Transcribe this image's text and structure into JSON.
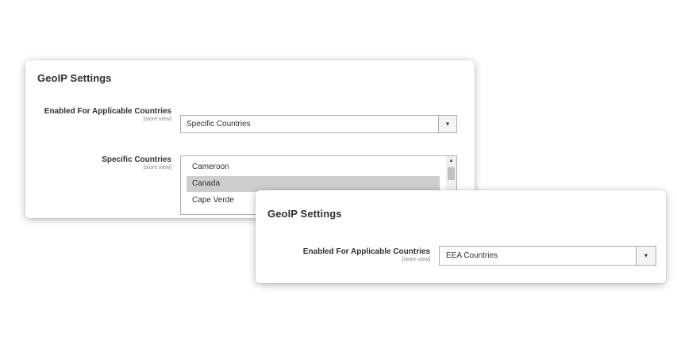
{
  "back_panel": {
    "title": "GeoIP Settings",
    "field1": {
      "label": "Enabled For Applicable Countries",
      "scope": "[store view]",
      "value": "Specific Countries",
      "arrow_icon": "triangle-down"
    },
    "field2": {
      "label": "Specific Countries",
      "scope": "[store view]",
      "options": [
        "Cameroon",
        "Canada",
        "Cape Verde"
      ],
      "selected": "Canada",
      "scroll_up_icon": "triangle-up"
    }
  },
  "front_panel": {
    "title": "GeoIP Settings",
    "field1": {
      "label": "Enabled For Applicable Countries",
      "scope": "[store view]",
      "value": "EEA Countries",
      "arrow_icon": "triangle-down"
    }
  },
  "colors": {
    "selected_option": "#cecece",
    "border": "#adadad",
    "label_text": "#303030",
    "scope_text": "#888888"
  }
}
